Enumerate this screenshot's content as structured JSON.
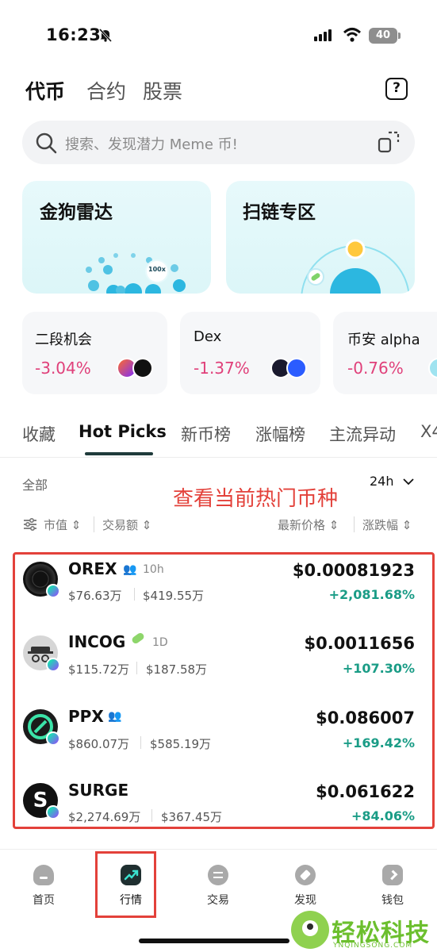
{
  "status_bar": {
    "time": "16:23",
    "battery": "40"
  },
  "top_tabs": [
    {
      "label": "代币",
      "active": true
    },
    {
      "label": "合约",
      "active": false
    },
    {
      "label": "股票",
      "active": false
    }
  ],
  "search": {
    "placeholder": "搜索、发现潜力 Meme 币!"
  },
  "banners": [
    {
      "title": "金狗雷达",
      "badge": "100x"
    },
    {
      "title": "扫链专区"
    }
  ],
  "market_cards": [
    {
      "title": "二段机会",
      "change": "-3.04%"
    },
    {
      "title": "Dex",
      "change": "-1.37%"
    },
    {
      "title": "币安 alpha",
      "change": "-0.76%"
    }
  ],
  "section_tabs": [
    "收藏",
    "Hot Picks",
    "新币榜",
    "涨幅榜",
    "主流异动",
    "X4"
  ],
  "filters": {
    "all": "全部",
    "timeframe": "24h",
    "sort_left": [
      "市值",
      "交易额"
    ],
    "sort_right": [
      "最新价格",
      "涨跌幅"
    ]
  },
  "annotation": "查看当前热门币种",
  "coins": [
    {
      "name": "OREX",
      "age": "10h",
      "market_cap": "$76.63万",
      "volume": "$419.55万",
      "price": "$0.00081923",
      "change": "+2,081.68%"
    },
    {
      "name": "INCOG",
      "age": "1D",
      "market_cap": "$115.72万",
      "volume": "$187.58万",
      "price": "$0.0011656",
      "change": "+107.30%"
    },
    {
      "name": "PPX",
      "age": "",
      "market_cap": "$860.07万",
      "volume": "$585.19万",
      "price": "$0.086007",
      "change": "+169.42%"
    },
    {
      "name": "SURGE",
      "age": "",
      "market_cap": "$2,274.69万",
      "volume": "$367.45万",
      "price": "$0.061622",
      "change": "+84.06%"
    }
  ],
  "bottom_nav": [
    {
      "label": "首页",
      "icon": "home-icon"
    },
    {
      "label": "行情",
      "icon": "market-icon",
      "active": true
    },
    {
      "label": "交易",
      "icon": "trade-icon"
    },
    {
      "label": "发现",
      "icon": "discover-icon"
    },
    {
      "label": "钱包",
      "icon": "wallet-icon"
    }
  ],
  "watermark": {
    "text": "轻松科技",
    "sub": "YNQINGSONG.COM"
  },
  "colors": {
    "negative": "#e0407a",
    "positive": "#1a9c86",
    "annotation": "#e3413a",
    "accent": "#1f3b3b"
  }
}
